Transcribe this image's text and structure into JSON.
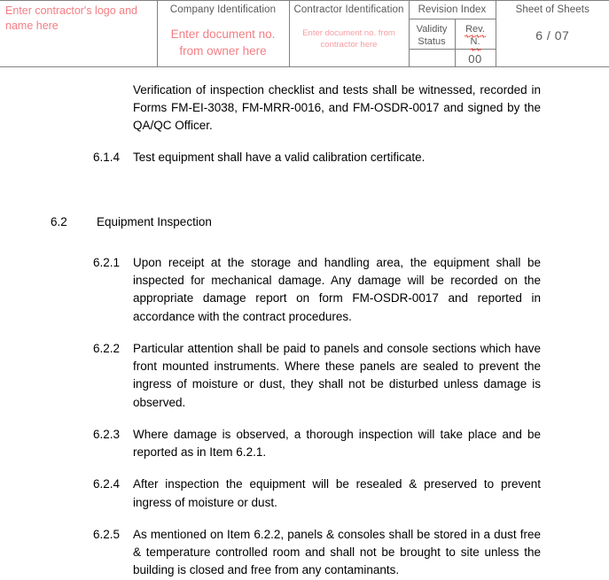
{
  "header": {
    "contractor_logo_placeholder": "Enter contractor's logo and name here",
    "company_identification_label": "Company Identification",
    "company_identification_placeholder": "Enter document no. from owner here",
    "contractor_identification_label": "Contractor Identification",
    "contractor_identification_placeholder": "Enter document no. from contractor here",
    "revision_index_label": "Revision Index",
    "validity_status_label": "Validity Status",
    "rev_no_label_part1": "Rev.",
    "rev_no_label_part2": "N.",
    "validity_status_value": "",
    "rev_no_value": "00",
    "sheet_of_sheets_label": "Sheet  of Sheets",
    "sheet_of_sheets_value": "6 / 07"
  },
  "colors": {
    "placeholder_red": "#f47e84",
    "placeholder_red_light": "#f79ca0",
    "table_border": "#808080",
    "header_text": "#595959",
    "spellcheck_underline": "#e02b20",
    "body_text": "#000000"
  },
  "body": {
    "continuation_paragraph": "Verification of inspection checklist and tests shall be witnessed, recorded in Forms FM-EI-3038, FM-MRR-0016, and FM-OSDR-0017 and signed by the QA/QC Officer.",
    "clauses": [
      {
        "number": "6.1.4",
        "text": "Test equipment shall have a valid calibration certificate."
      },
      {
        "number": "6.2",
        "text": "Equipment Inspection"
      },
      {
        "number": "6.2.1",
        "text": "Upon receipt at the storage and handling area, the equipment shall be inspected for mechanical damage.  Any damage will be recorded on the appropriate damage report on form FM-OSDR-0017 and reported in accordance with the contract procedures."
      },
      {
        "number": "6.2.2",
        "text": "Particular attention shall be paid to panels and console sections which have front mounted instruments. Where these panels are sealed to prevent the ingress of moisture or dust, they shall not be disturbed unless damage is observed."
      },
      {
        "number": "6.2.3",
        "text": "Where damage is observed, a thorough inspection will take place and be reported as in Item 6.2.1."
      },
      {
        "number": "6.2.4",
        "text": "After inspection the equipment will be resealed & preserved to prevent ingress of moisture or dust."
      },
      {
        "number": "6.2.5",
        "text": "As mentioned on Item 6.2.2, panels & consoles shall be stored in a dust free & temperature controlled room and shall not be brought to site unless the building is closed and free from any contaminants."
      }
    ]
  }
}
